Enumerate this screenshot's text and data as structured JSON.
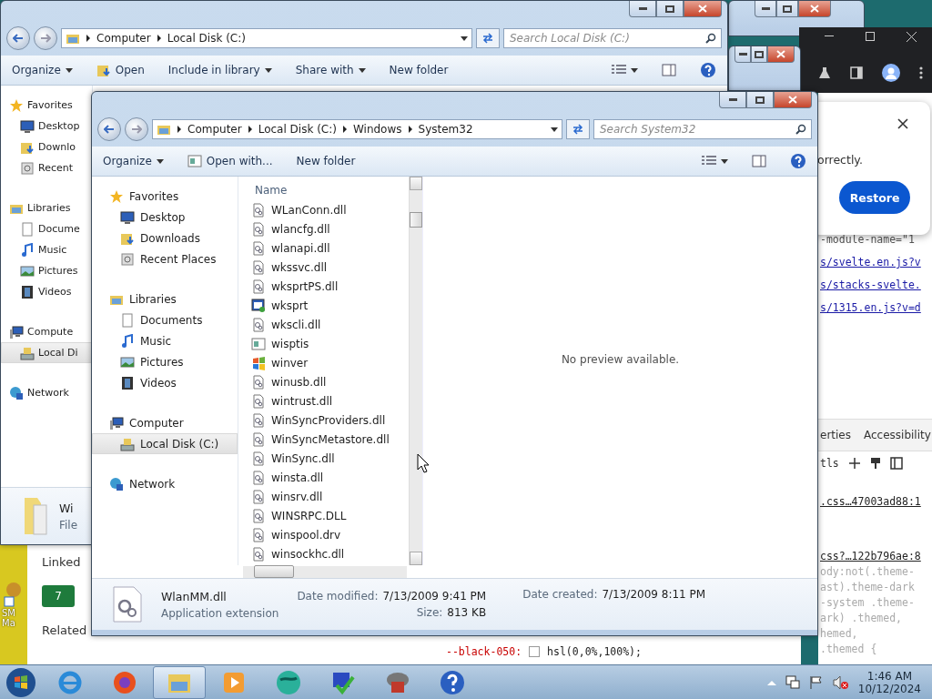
{
  "back_explorer": {
    "address": [
      "Computer",
      "Local Disk (C:)"
    ],
    "search": {
      "placeholder": "Search Local Disk (C:)"
    },
    "toolbar": [
      {
        "label": "Organize",
        "menu": true,
        "kind": "plain"
      },
      {
        "label": "Open",
        "menu": false,
        "kind": "open"
      },
      {
        "label": "Include in library",
        "menu": true,
        "kind": "plain"
      },
      {
        "label": "Share with",
        "menu": true,
        "kind": "plain"
      },
      {
        "label": "New folder",
        "menu": false,
        "kind": "plain"
      }
    ],
    "nav": [
      {
        "label": "Favorites",
        "kind": "star",
        "selected": false,
        "children": [
          {
            "label": "Desktop",
            "kind": "desktop",
            "selected": false
          },
          {
            "label": "Downlo",
            "kind": "downloads",
            "selected": false
          },
          {
            "label": "Recent",
            "kind": "recent",
            "selected": false
          }
        ]
      },
      {
        "label": "Libraries",
        "kind": "library",
        "selected": false,
        "children": [
          {
            "label": "Docume",
            "kind": "document",
            "selected": false
          },
          {
            "label": "Music",
            "kind": "music",
            "selected": false
          },
          {
            "label": "Pictures",
            "kind": "pictures",
            "selected": false
          },
          {
            "label": "Videos",
            "kind": "videos",
            "selected": false
          }
        ]
      },
      {
        "label": "Compute",
        "kind": "computer",
        "selected": false,
        "children": [
          {
            "label": "Local Di",
            "kind": "disk",
            "selected": true
          }
        ]
      },
      {
        "label": "Network",
        "kind": "network",
        "selected": false
      }
    ],
    "details": {
      "name": "Wi",
      "type": "File"
    }
  },
  "browser": {
    "popup": {
      "text": "orrectly.",
      "button": "Restore"
    },
    "source_lines": [
      {
        "text": "-module-name=\"1",
        "link": false
      },
      {
        "text": "s/svelte.en.js?v",
        "link": true
      },
      {
        "text": "s/stacks-svelte.",
        "link": true
      },
      {
        "text": "s/1315.en.js?v=d",
        "link": true
      }
    ],
    "devtools_tabs": [
      "erties",
      "Accessibility"
    ],
    "filter": "tls",
    "style_lines": [
      {
        "text": ".css…47003ad88:1",
        "kind": "link"
      },
      {
        "text": "css?…122b796ae:8",
        "kind": "link"
      },
      {
        "text": "ody:not(.theme-",
        "kind": "dim"
      },
      {
        "text": "ast).theme-dark",
        "kind": "dim"
      },
      {
        "text": "-system .theme-",
        "kind": "dim"
      },
      {
        "text": "ark) .themed,",
        "kind": "dim"
      },
      {
        "text": "hemed,",
        "kind": "dim"
      },
      {
        "text": ".themed {",
        "kind": "dim"
      }
    ],
    "variable": {
      "name": "--black-050:",
      "value": "hsl(0,0%,100%);"
    }
  },
  "web_page": {
    "heading": "Linked",
    "badge": "7",
    "heading_2": "Related"
  },
  "desktop_icon": {
    "label": "SM Ma"
  },
  "front_explorer": {
    "address": [
      "Computer",
      "Local Disk (C:)",
      "Windows",
      "System32"
    ],
    "search": {
      "placeholder": "Search System32"
    },
    "toolbar": [
      {
        "label": "Organize",
        "menu": true,
        "kind": "plain"
      },
      {
        "label": "Open with...",
        "menu": false,
        "kind": "openwith"
      },
      {
        "label": "New folder",
        "menu": false,
        "kind": "plain"
      }
    ],
    "nav": [
      {
        "label": "Favorites",
        "kind": "star",
        "selected": false,
        "children": [
          {
            "label": "Desktop",
            "kind": "desktop",
            "selected": false
          },
          {
            "label": "Downloads",
            "kind": "downloads",
            "selected": false
          },
          {
            "label": "Recent Places",
            "kind": "recent",
            "selected": false
          }
        ]
      },
      {
        "label": "Libraries",
        "kind": "library",
        "selected": false,
        "children": [
          {
            "label": "Documents",
            "kind": "document",
            "selected": false
          },
          {
            "label": "Music",
            "kind": "music",
            "selected": false
          },
          {
            "label": "Pictures",
            "kind": "pictures",
            "selected": false
          },
          {
            "label": "Videos",
            "kind": "videos",
            "selected": false
          }
        ]
      },
      {
        "label": "Computer",
        "kind": "computer",
        "selected": false,
        "children": [
          {
            "label": "Local Disk (C:)",
            "kind": "disk",
            "selected": true
          }
        ]
      },
      {
        "label": "Network",
        "kind": "network",
        "selected": false
      }
    ],
    "column": "Name",
    "files": [
      {
        "name": "WLanConn.dll",
        "kind": "dll"
      },
      {
        "name": "wlancfg.dll",
        "kind": "dll"
      },
      {
        "name": "wlanapi.dll",
        "kind": "dll"
      },
      {
        "name": "wkssvc.dll",
        "kind": "dll"
      },
      {
        "name": "wksprtPS.dll",
        "kind": "dll"
      },
      {
        "name": "wksprt",
        "kind": "app"
      },
      {
        "name": "wkscli.dll",
        "kind": "dll"
      },
      {
        "name": "wisptis",
        "kind": "window"
      },
      {
        "name": "winver",
        "kind": "flag"
      },
      {
        "name": "winusb.dll",
        "kind": "dll"
      },
      {
        "name": "wintrust.dll",
        "kind": "dll"
      },
      {
        "name": "WinSyncProviders.dll",
        "kind": "dll"
      },
      {
        "name": "WinSyncMetastore.dll",
        "kind": "dll"
      },
      {
        "name": "WinSync.dll",
        "kind": "dll"
      },
      {
        "name": "winsta.dll",
        "kind": "dll"
      },
      {
        "name": "winsrv.dll",
        "kind": "dll"
      },
      {
        "name": "WINSRPC.DLL",
        "kind": "dll"
      },
      {
        "name": "winspool.drv",
        "kind": "dll"
      },
      {
        "name": "winsockhc.dll",
        "kind": "dll"
      }
    ],
    "preview": "No preview available.",
    "details": {
      "name": "WlanMM.dll",
      "type": "Application extension",
      "fields": [
        {
          "label": "Date modified:",
          "value": "7/13/2009 9:41 PM"
        },
        {
          "label": "Size:",
          "value": "813 KB"
        },
        {
          "label": "Date created:",
          "value": "7/13/2009 8:11 PM"
        }
      ]
    }
  },
  "taskbar": {
    "apps": [
      {
        "kind": "ie",
        "selected": false
      },
      {
        "kind": "firefox",
        "selected": false
      },
      {
        "kind": "explorer",
        "selected": true
      },
      {
        "kind": "media",
        "selected": false
      },
      {
        "kind": "globe",
        "selected": false
      },
      {
        "kind": "check",
        "selected": false
      },
      {
        "kind": "cloud",
        "selected": false
      },
      {
        "kind": "help",
        "selected": false
      }
    ],
    "time": "1:46 AM",
    "date": "10/12/2024"
  }
}
